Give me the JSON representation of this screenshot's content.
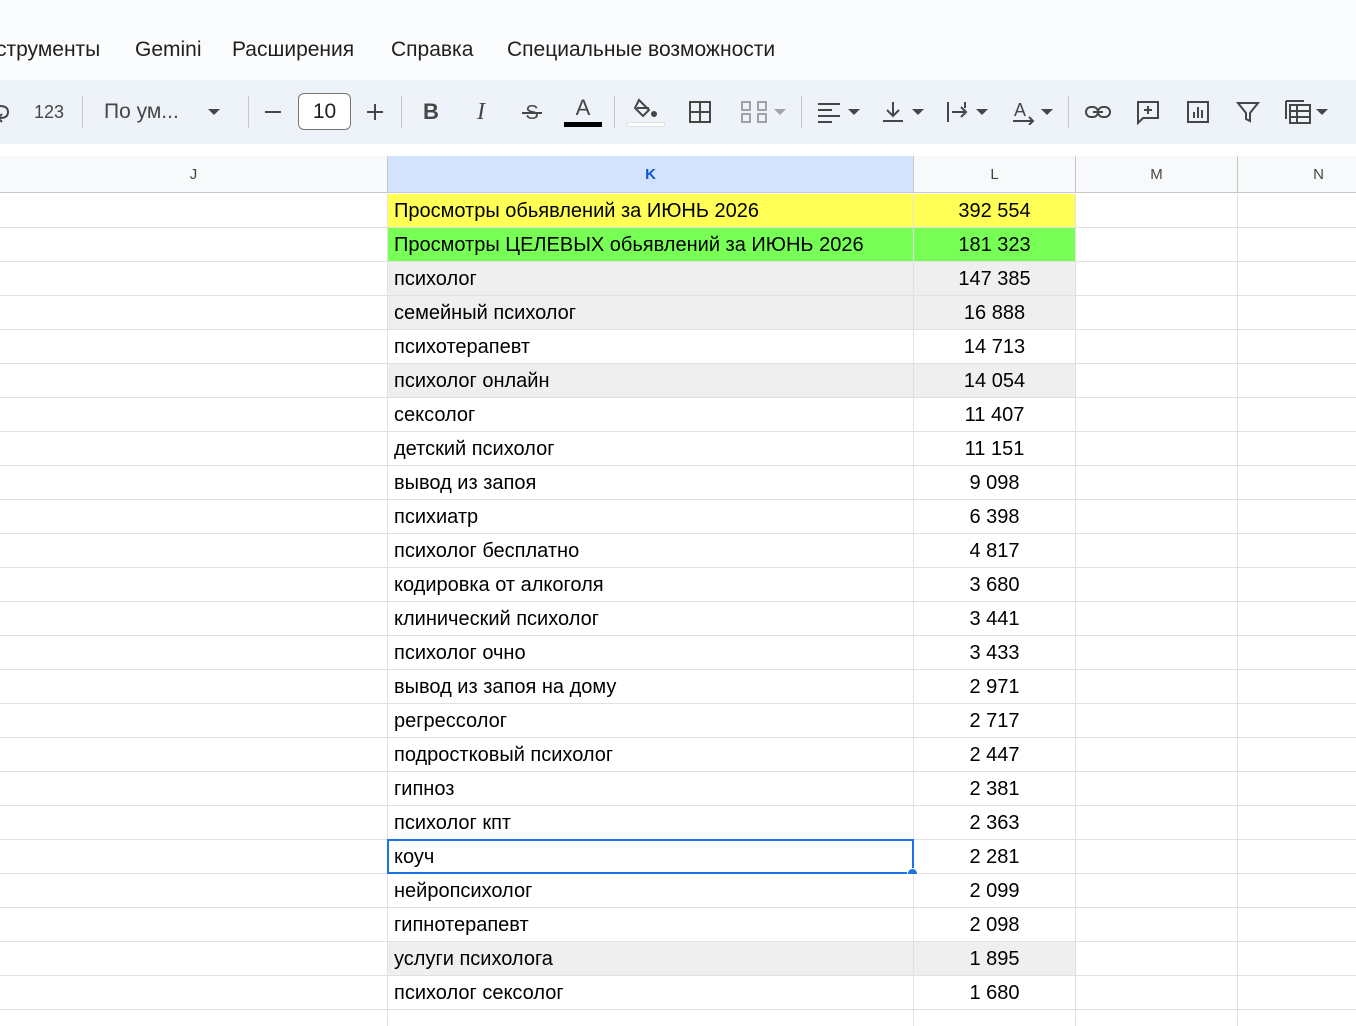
{
  "menu": {
    "items": [
      {
        "label": "струменты"
      },
      {
        "label": "Gemini"
      },
      {
        "label": "Расширения"
      },
      {
        "label": "Справка"
      },
      {
        "label": "Специальные возможности"
      }
    ]
  },
  "toolbar": {
    "number_format_label": "123",
    "font_name": "По ум...",
    "font_size": "10",
    "text_color": "#000000",
    "fill_color": "#ffffff"
  },
  "columns": [
    "J",
    "K",
    "L",
    "M",
    "N"
  ],
  "selected_column": "K",
  "rows": [
    {
      "k": "Просмотры обьявлений за ИЮНЬ 2026",
      "l": "392 554",
      "bg": "#ffff55"
    },
    {
      "k": "Просмотры ЦЕЛЕВЫХ обьявлений за ИЮНЬ 2026",
      "l": "181 323",
      "bg": "#77ff55"
    },
    {
      "k": "психолог",
      "l": "147 385",
      "bg": "#efefef"
    },
    {
      "k": "семейный психолог",
      "l": "16 888",
      "bg": "#efefef"
    },
    {
      "k": "психотерапевт",
      "l": "14 713",
      "bg": "#ffffff"
    },
    {
      "k": "психолог онлайн",
      "l": "14 054",
      "bg": "#efefef"
    },
    {
      "k": "сексолог",
      "l": "11 407",
      "bg": "#ffffff"
    },
    {
      "k": "детский психолог",
      "l": "11 151",
      "bg": "#ffffff"
    },
    {
      "k": "вывод из запоя",
      "l": "9 098",
      "bg": "#ffffff"
    },
    {
      "k": "психиатр",
      "l": "6 398",
      "bg": "#ffffff"
    },
    {
      "k": "психолог бесплатно",
      "l": "4 817",
      "bg": "#ffffff"
    },
    {
      "k": "кодировка от алкоголя",
      "l": "3 680",
      "bg": "#ffffff"
    },
    {
      "k": "клинический психолог",
      "l": "3 441",
      "bg": "#ffffff"
    },
    {
      "k": "психолог очно",
      "l": "3 433",
      "bg": "#ffffff"
    },
    {
      "k": "вывод из запоя на дому",
      "l": "2 971",
      "bg": "#ffffff"
    },
    {
      "k": "регрессолог",
      "l": "2 717",
      "bg": "#ffffff"
    },
    {
      "k": "подростковый психолог",
      "l": "2 447",
      "bg": "#ffffff"
    },
    {
      "k": "гипноз",
      "l": "2 381",
      "bg": "#ffffff"
    },
    {
      "k": "психолог кпт",
      "l": "2 363",
      "bg": "#ffffff"
    },
    {
      "k": "коуч",
      "l": "2 281",
      "bg": "#ffffff",
      "selected": true
    },
    {
      "k": "нейропсихолог",
      "l": "2 099",
      "bg": "#ffffff"
    },
    {
      "k": "гипнотерапевт",
      "l": "2 098",
      "bg": "#ffffff"
    },
    {
      "k": "услуги психолога",
      "l": "1 895",
      "bg": "#efefef"
    },
    {
      "k": "психолог сексолог",
      "l": "1 680",
      "bg": "#ffffff"
    },
    {
      "k": "",
      "l": "",
      "bg": "#ffffff"
    }
  ]
}
